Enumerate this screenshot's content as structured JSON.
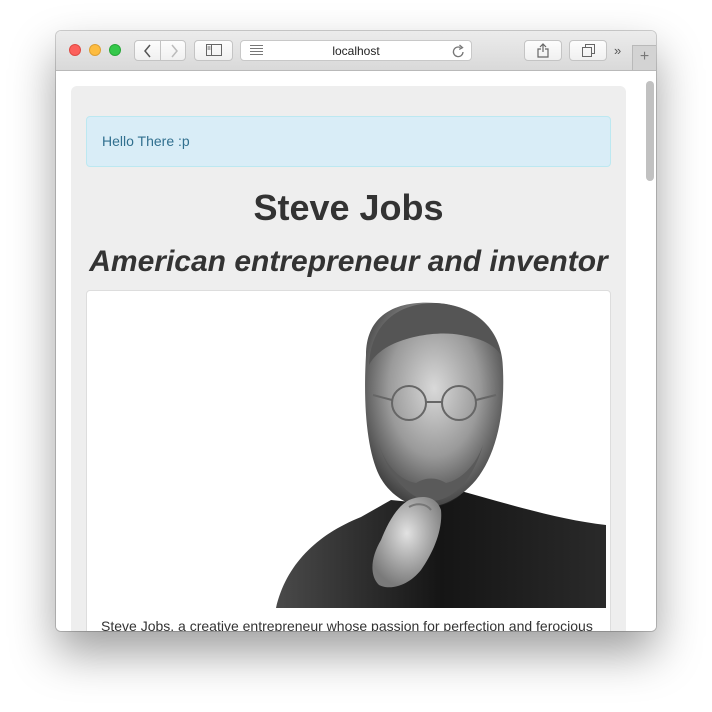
{
  "browser": {
    "address": "localhost",
    "new_tab_symbol": "+",
    "more_symbol": "»"
  },
  "page": {
    "alert_text": "Hello There :p",
    "title": "Steve Jobs",
    "subtitle": "American entrepreneur and inventor",
    "image_alt": "Steve Jobs portrait",
    "caption": "Steve Jobs, a creative entrepreneur whose passion for perfection and ferocious"
  },
  "icons": {
    "back": "chevron-left-icon",
    "forward": "chevron-right-icon",
    "sidebar": "sidebar-icon",
    "reader": "reader-icon",
    "reload": "reload-icon",
    "share": "share-icon",
    "tabs": "tabs-icon"
  },
  "colors": {
    "alert_bg": "#d9edf7",
    "alert_text": "#31708f",
    "jumbotron_bg": "#eeeeee",
    "traffic_red": "#fc605c",
    "traffic_yellow": "#fdbc40",
    "traffic_green": "#34c84a"
  }
}
